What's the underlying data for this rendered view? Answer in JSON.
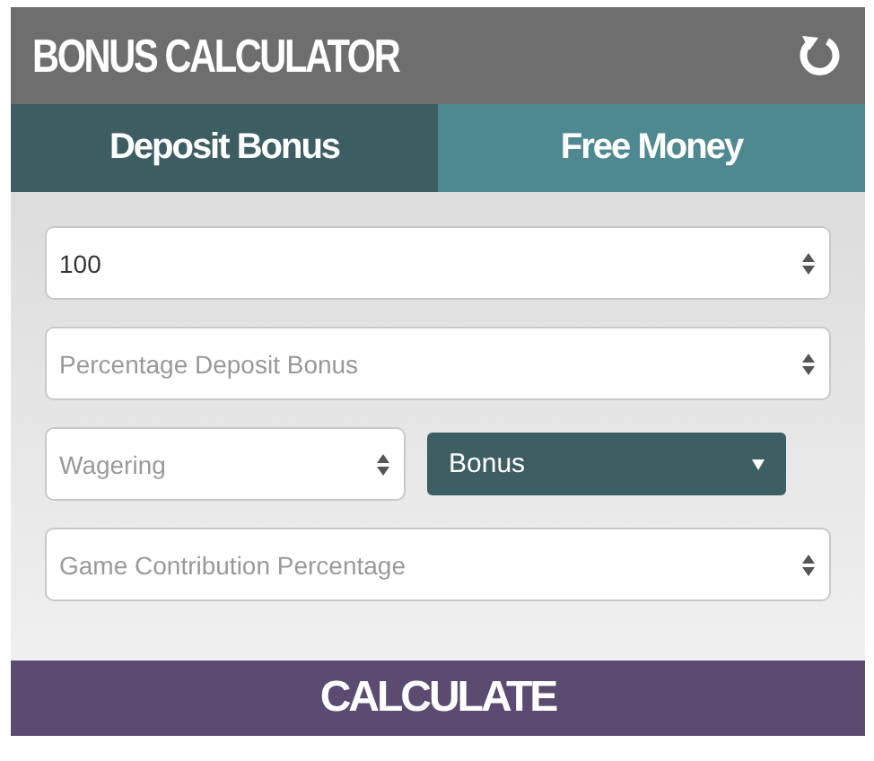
{
  "header": {
    "title": "BONUS CALCULATOR"
  },
  "tabs": [
    {
      "label": "Deposit Bonus",
      "selected": true
    },
    {
      "label": "Free Money",
      "selected": false
    }
  ],
  "fields": [
    {
      "kind": "number",
      "value": "100"
    },
    {
      "kind": "number",
      "placeholder": "Percentage Deposit Bonus"
    },
    {
      "kind": "pair",
      "left": {
        "kind": "number",
        "placeholder": "Wagering"
      },
      "right": {
        "kind": "select",
        "value": "Bonus"
      }
    },
    {
      "kind": "number",
      "placeholder": "Game Contribution Percentage"
    }
  ],
  "button": {
    "label": "CALCULATE"
  }
}
